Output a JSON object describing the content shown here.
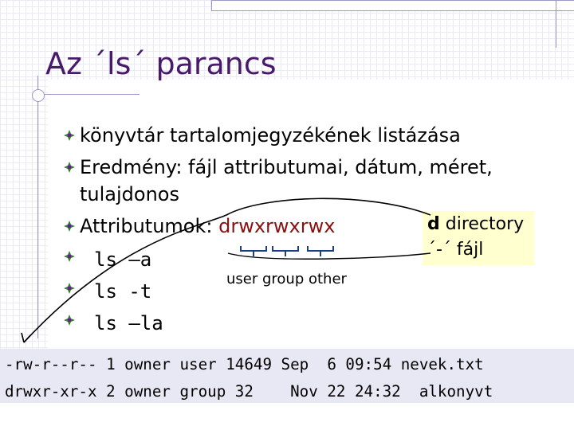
{
  "slide": {
    "title": "Az ´ls´ parancs",
    "bullets": [
      "könyvtár tartalomjegyzékének listázása",
      "Eredmény: fájl attributumai, dátum, méret,",
      "tulajdonos",
      "Attributumok: ",
      "drwxrwxrwx"
    ],
    "commands": [
      "ls –a",
      "ls -t",
      "ls –la"
    ],
    "groups_label": "user group other",
    "note": {
      "d": "d",
      "d_text": " directory",
      "dash": "´-´ fájl"
    },
    "terminal": [
      "-rw-r--r-- 1 owner user 14649 Sep  6 09:54 nevek.txt",
      "drwxr-xr-x 2 owner group 32    Nov 22 24:32  alkonyvt"
    ],
    "colors": {
      "title": "#4a1a6a",
      "accent": "#8b1010",
      "bullet": "#2e7d32"
    }
  }
}
